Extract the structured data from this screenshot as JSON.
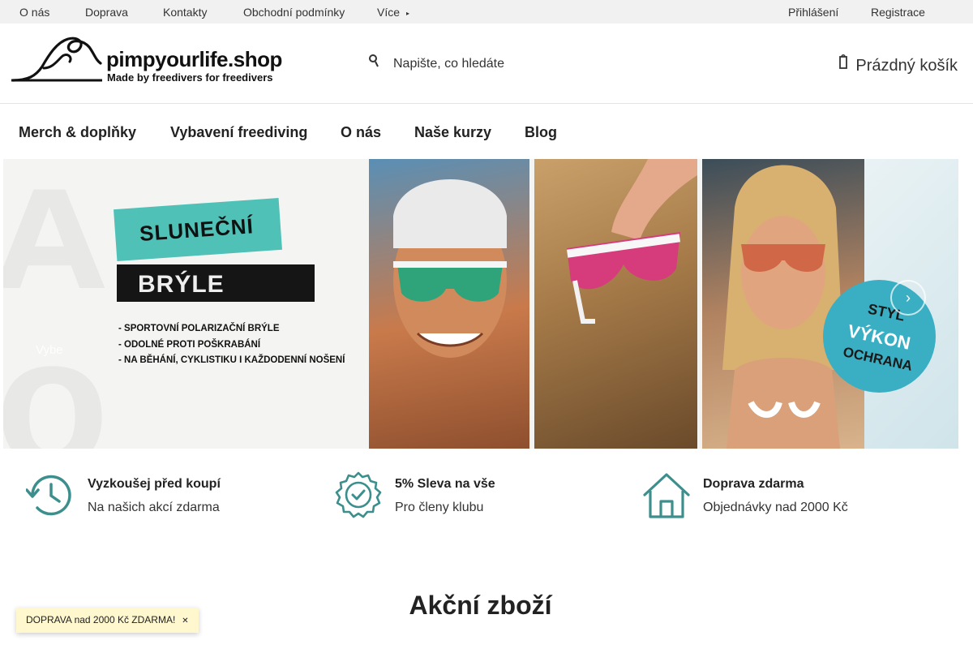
{
  "topbar": {
    "links": [
      "O nás",
      "Doprava",
      "Kontakty",
      "Obchodní podmínky",
      "Více"
    ],
    "more_caret": "▸",
    "login": "Přihlášení",
    "register": "Registrace"
  },
  "header": {
    "logo_name": "pimpyourlife.shop",
    "logo_tagline": "Made by freedivers for freedivers",
    "search_icon": "search-icon",
    "search_placeholder": "Napište, co hledáte",
    "cart_icon": "cart-icon",
    "cart_label": "Prázdný košík"
  },
  "mainnav": {
    "items": [
      "Merch & doplňky",
      "Vybavení freediving",
      "O nás",
      "Naše kurzy",
      "Blog"
    ]
  },
  "hero": {
    "tag1": "SLUNEČNÍ",
    "tag2": "BRÝLE",
    "bullets": [
      "- SPORTOVNÍ POLARIZAČNÍ BRÝLE",
      "- ODOLNÉ PROTI POŠKRABÁNÍ",
      "- NA BĚHÁNÍ, CYKLISTIKU I KAŽDODENNÍ NOŠENÍ"
    ],
    "ghost_text": "Vybe",
    "badge": [
      "STYL",
      "VÝKON",
      "OCHRANA"
    ],
    "slider_button_icon": "chevron-icon"
  },
  "benefits": [
    {
      "icon": "history-clock-icon",
      "title": "Vyzkoušej před koupí",
      "subtitle": "Na našich akcí zdarma"
    },
    {
      "icon": "badge-check-icon",
      "title": "5% Sleva na vše",
      "subtitle": "Pro členy klubu"
    },
    {
      "icon": "home-icon",
      "title": "Doprava zdarma",
      "subtitle": "Objednávky nad 2000 Kč"
    }
  ],
  "section": {
    "title": "Akční zboží"
  },
  "shipping_notice": {
    "text": "DOPRAVA nad 2000 Kč ZDARMA!",
    "close_icon": "close-icon"
  },
  "colors": {
    "accent_teal": "#3aaec2",
    "green_tag": "#4fc1b7",
    "topbar_bg": "#f1f1f1",
    "pill_bg": "#fff8cf"
  }
}
